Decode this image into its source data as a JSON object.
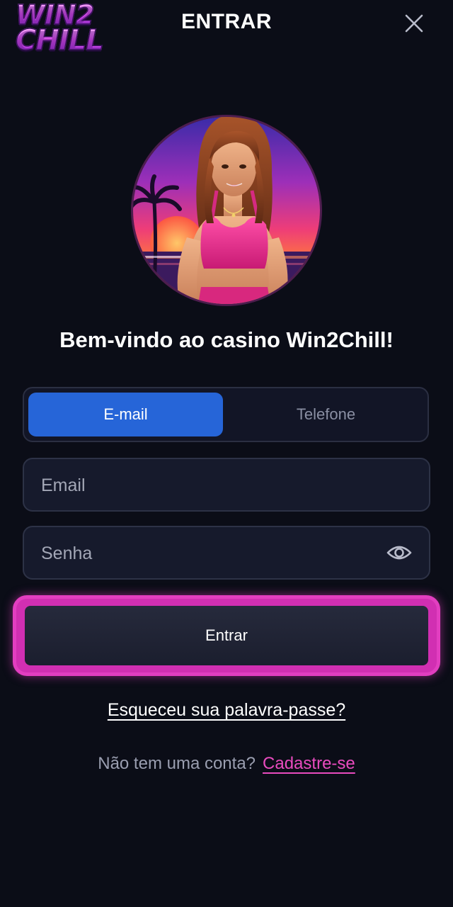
{
  "header": {
    "logo_line1": "WIN2",
    "logo_line2": "CHILL",
    "title": "ENTRAR",
    "close_icon": "close-icon"
  },
  "avatar": {
    "description_icon": "avatar-illustration"
  },
  "welcome": "Bem-vindo ao casino Win2Chill!",
  "tabs": [
    {
      "label": "E-mail",
      "active": true
    },
    {
      "label": "Telefone",
      "active": false
    }
  ],
  "form": {
    "email_placeholder": "Email",
    "email_value": "",
    "password_placeholder": "Senha",
    "password_value": "",
    "password_toggle_icon": "eye-icon",
    "submit_label": "Entrar"
  },
  "links": {
    "forgot": "Esqueceu sua palavra-passe?",
    "no_account": "Não tem uma conta?",
    "signup": "Cadastre-se"
  },
  "colors": {
    "background": "#0b0d17",
    "accent_blue": "#2665d8",
    "accent_pink": "#e23ec0",
    "signup_link": "#e94bbf"
  }
}
